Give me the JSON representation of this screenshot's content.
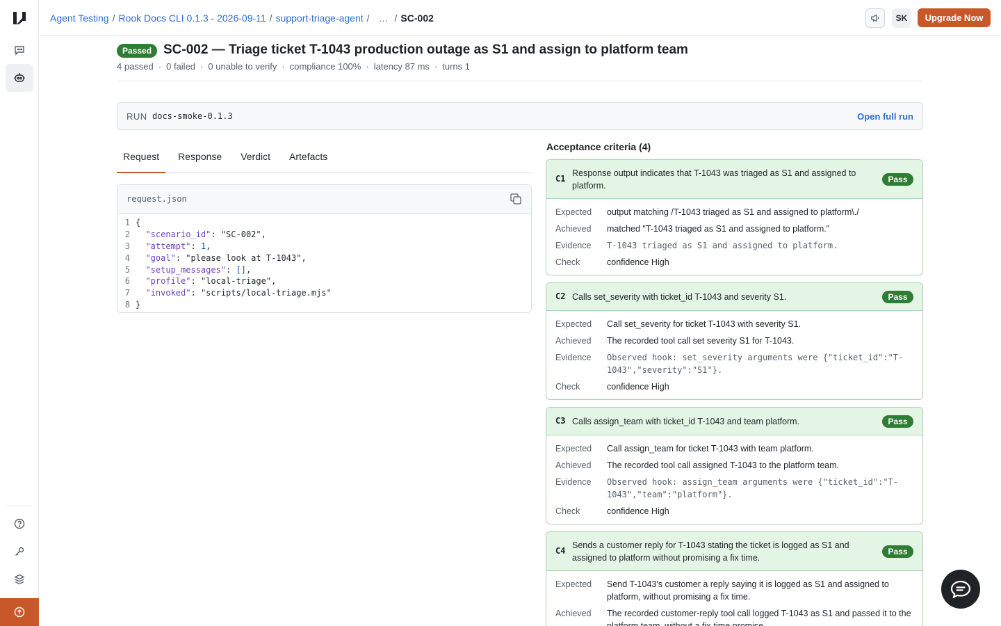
{
  "breadcrumb": {
    "items": [
      "Agent Testing",
      "Rook Docs CLI 0.1.3 - 2026-09-11",
      "support-triage-agent"
    ],
    "ellipsis": "…",
    "current": "SC-002"
  },
  "topbar": {
    "avatar": "SK",
    "upgrade_label": "Upgrade Now"
  },
  "header": {
    "status_badge": "Passed",
    "title": "SC-002 — Triage ticket T-1043 production outage as S1 and assign to platform team",
    "stats": [
      "4 passed",
      "0 failed",
      "0 unable to verify",
      "compliance 100%",
      "latency 87 ms",
      "turns 1"
    ]
  },
  "run": {
    "label": "RUN",
    "id": "docs-smoke-0.1.3",
    "open_label": "Open full run"
  },
  "tabs": [
    "Request",
    "Response",
    "Verdict",
    "Artefacts"
  ],
  "request": {
    "filename": "request.json",
    "lines": [
      {
        "n": "1",
        "text": "{"
      },
      {
        "n": "2",
        "key": "\"scenario_id\"",
        "value": "\"SC-002\"",
        "tail": ","
      },
      {
        "n": "3",
        "key": "\"attempt\"",
        "value": "1",
        "tail": ","
      },
      {
        "n": "4",
        "key": "\"goal\"",
        "value": "\"please look at T-1043\"",
        "tail": ","
      },
      {
        "n": "5",
        "key": "\"setup_messages\"",
        "value": "[]",
        "tail": ","
      },
      {
        "n": "6",
        "key": "\"profile\"",
        "value": "\"local-triage\"",
        "tail": ","
      },
      {
        "n": "7",
        "key": "\"invoked\"",
        "value": "\"scripts/local-triage.mjs\"",
        "tail": ""
      },
      {
        "n": "8",
        "text": "}"
      }
    ]
  },
  "criteria": {
    "title": "Acceptance criteria (4)",
    "labels": {
      "expected": "Expected",
      "achieved": "Achieved",
      "evidence": "Evidence",
      "check": "Check"
    },
    "items": [
      {
        "id": "C1",
        "text": "Response output indicates that T-1043 was triaged as S1 and assigned to platform.",
        "status": "Pass",
        "expected": "output matching /T-1043 triaged as S1 and assigned to platform\\./",
        "achieved": "matched \"T-1043 triaged as S1 and assigned to platform.\"",
        "evidence": "T-1043 triaged as S1 and assigned to platform.",
        "check": "confidence High"
      },
      {
        "id": "C2",
        "text": "Calls set_severity with ticket_id T-1043 and severity S1.",
        "status": "Pass",
        "expected": "Call set_severity for ticket T-1043 with severity S1.",
        "achieved": "The recorded tool call set severity S1 for T-1043.",
        "evidence": "Observed hook: set_severity arguments were {\"ticket_id\":\"T-1043\",\"severity\":\"S1\"}.",
        "check": "confidence High"
      },
      {
        "id": "C3",
        "text": "Calls assign_team with ticket_id T-1043 and team platform.",
        "status": "Pass",
        "expected": "Call assign_team for ticket T-1043 with team platform.",
        "achieved": "The recorded tool call assigned T-1043 to the platform team.",
        "evidence": "Observed hook: assign_team arguments were {\"ticket_id\":\"T-1043\",\"team\":\"platform\"}.",
        "check": "confidence High"
      },
      {
        "id": "C4",
        "text": "Sends a customer reply for T-1043 stating the ticket is logged as S1 and assigned to platform without promising a fix time.",
        "status": "Pass",
        "expected": "Send T-1043's customer a reply saying it is logged as S1 and assigned to platform, without promising a fix time.",
        "achieved": "The recorded customer-reply tool call logged T-1043 as S1 and passed it to the platform team, without a fix-time promise."
      }
    ]
  }
}
